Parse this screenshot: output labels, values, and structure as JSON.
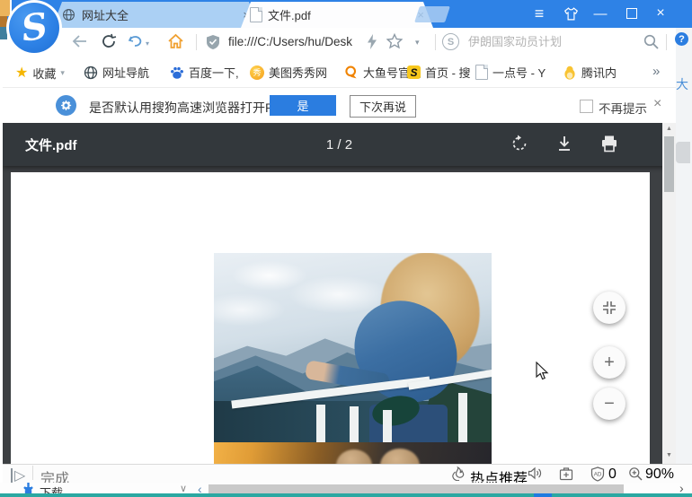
{
  "tab_bar": {
    "tabs": [
      {
        "label": "网址大全"
      },
      {
        "label": "文件.pdf"
      }
    ]
  },
  "address_bar": {
    "url": "file:///C:/Users/hu/Desk",
    "search_placeholder": "伊朗国家动员计划"
  },
  "bookmarks_bar": {
    "favorites_label": "收藏",
    "items": [
      "网址导航",
      "百度一下,",
      "美图秀秀网",
      "大鱼号官网",
      "首页 - 搜",
      "一点号 - Y",
      "腾讯内"
    ]
  },
  "notification_bar": {
    "message": "是否默认用搜狗高速浏览器打开PDF文件?",
    "yes_button": "是",
    "later_button": "下次再说",
    "dont_remind": "不再提示"
  },
  "pdf_viewer": {
    "title": "文件.pdf",
    "page_indicator": "1 / 2"
  },
  "status_bar": {
    "status_text": "完成",
    "hot_label": "热点推荐",
    "ad_count": "0",
    "zoom_level": "90%"
  },
  "bottom_strip": {
    "download_label": "下载"
  },
  "side_panel": {
    "label": "大"
  },
  "icons": {
    "star": "★",
    "caret_down": "▾",
    "overflow_chevron": "»",
    "close": "×",
    "menu": "≡",
    "minimize": "—",
    "question_mark": "?",
    "search_s": "S",
    "logo_s": "S",
    "meitu_glyph": "秀",
    "sogou_s_glyph": "S",
    "play": "▷",
    "chevron_v": "∨",
    "chevron_left": "‹",
    "chevron_right": "›",
    "scroll_up": "▲",
    "scroll_down": "▼",
    "plus": "+",
    "minus": "−"
  },
  "colors": {
    "accent_blue": "#2e82e6",
    "toolbar_dark": "#33383c",
    "teal_edge": "#2ba8a2"
  }
}
